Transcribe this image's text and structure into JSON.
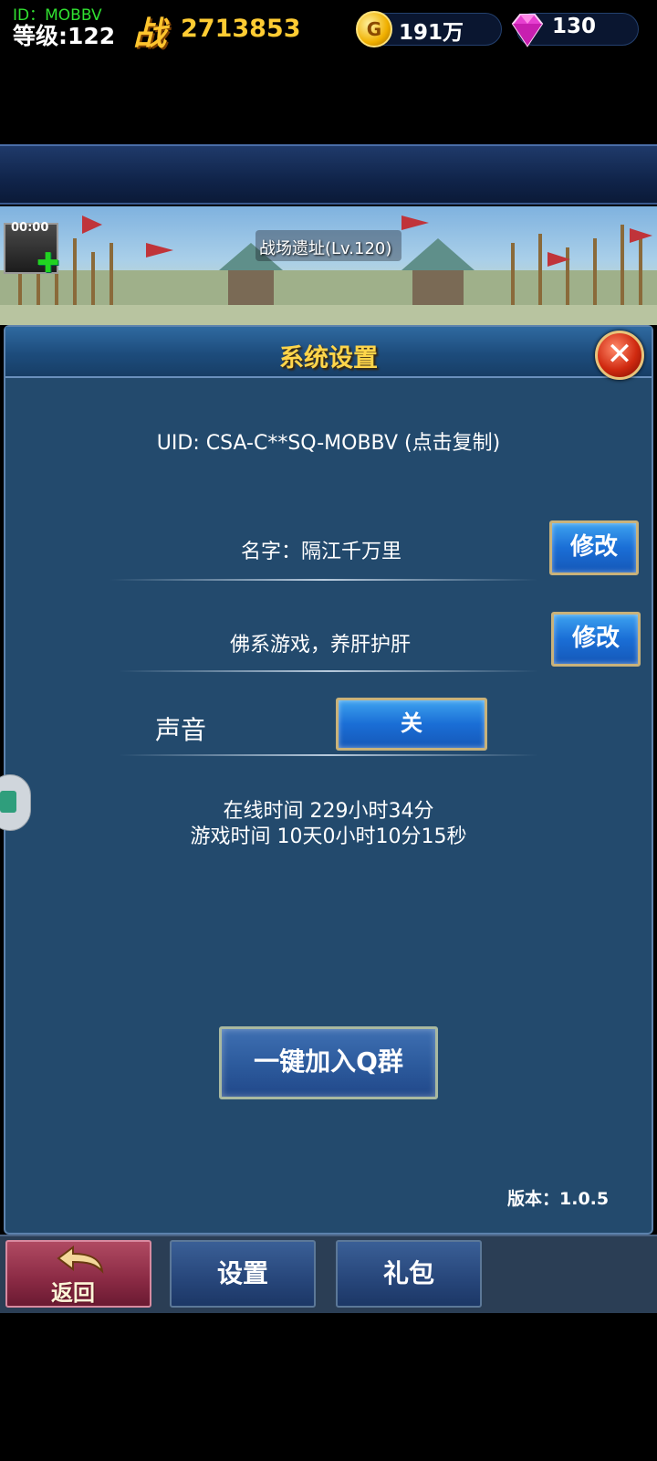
{
  "player": {
    "id": "ID：MOBBV",
    "level": "等级:122",
    "power_icon": "战",
    "power_value": "2713853"
  },
  "resources": {
    "gold_icon": "G",
    "gold": "191万",
    "gems": "130"
  },
  "scene": {
    "timer": "00:00",
    "location": "战场遗址(Lv.120)"
  },
  "panel": {
    "title": "系统设置",
    "uid": "UID: CSA-C**SQ-MOBBV (点击复制)",
    "name_label": "名字：隔江千万里",
    "name_edit": "修改",
    "signature": "佛系游戏，养肝护肝",
    "signature_edit": "修改",
    "sound_label": "声音",
    "sound_toggle": "关",
    "online_time": "在线时间 229小时34分",
    "game_time": "游戏时间 10天0小时10分15秒",
    "join_group": "一键加入Q群",
    "version": "版本：1.0.5"
  },
  "nav": {
    "back": "返回",
    "settings": "设置",
    "gift": "礼包"
  },
  "colors": {
    "panel_bg": "#234a6d",
    "title_gold": "#ffd54a",
    "button_blue": "#1a6ed6",
    "id_green": "#31e031"
  }
}
